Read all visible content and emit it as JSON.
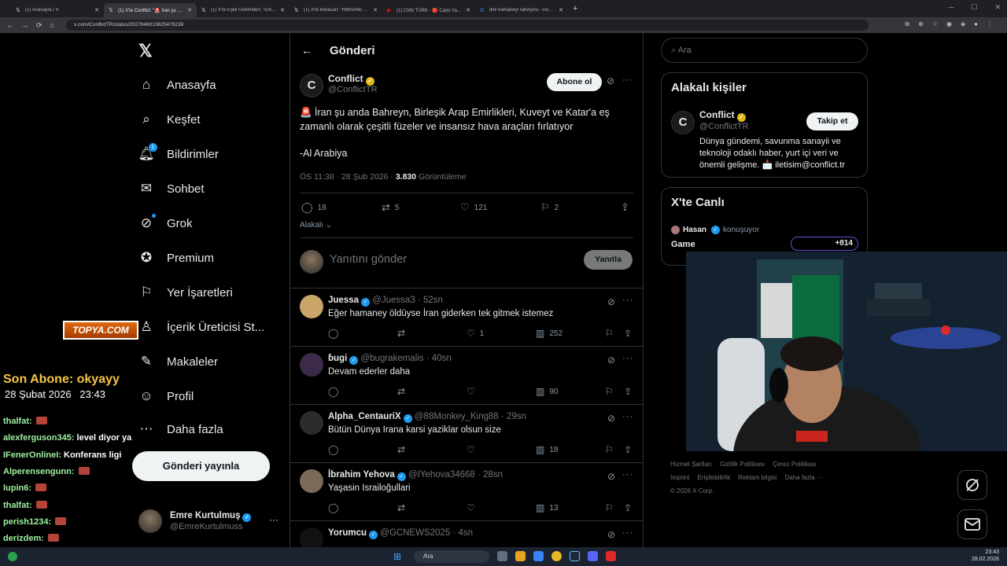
{
  "browser": {
    "tabs": [
      {
        "label": "(1) Anasayfa / X",
        "icon": "x-icon",
        "active": false
      },
      {
        "label": "(1) X'te Conflict: \"🚨 İran şu an...",
        "icon": "x-icon",
        "active": true
      },
      {
        "label": "(1) X'te Eşkil Üretimden: \"Emre...",
        "icon": "x-icon",
        "active": false
      },
      {
        "label": "(1) X'te Boracan: \"Hiltmi//Bu ulu...",
        "icon": "x-icon",
        "active": false
      },
      {
        "label": "(1) CNN TÜRK - 🔴 Canlı Yayın",
        "icon": "youtube-icon",
        "active": false
      },
      {
        "label": "dini hamaneyı takviyesi - Goog...",
        "icon": "google-icon",
        "active": false
      }
    ],
    "url": "x.com/ConflictTR/status/2027846013625479238"
  },
  "nav": {
    "items": [
      {
        "label": "Anasayfa",
        "icon": "home-icon"
      },
      {
        "label": "Keşfet",
        "icon": "search-icon"
      },
      {
        "label": "Bildirimler",
        "icon": "bell-icon",
        "badge": "1"
      },
      {
        "label": "Sohbet",
        "icon": "mail-icon"
      },
      {
        "label": "Grok",
        "icon": "grok-icon"
      },
      {
        "label": "Premium",
        "icon": "premium-icon"
      },
      {
        "label": "Yer İşaretleri",
        "icon": "bookmark-icon"
      },
      {
        "label": "İçerik Üreticisi St...",
        "icon": "creator-studio-icon"
      },
      {
        "label": "Makaleler",
        "icon": "articles-icon"
      },
      {
        "label": "Profil",
        "icon": "profile-icon"
      },
      {
        "label": "Daha fazla",
        "icon": "more-icon"
      }
    ],
    "post_button": "Gönderi yayınla",
    "account": {
      "name": "Emre Kurtulmuş",
      "handle": "@EmreKurtulmuss"
    }
  },
  "main": {
    "header": "Gönderi",
    "tweet": {
      "author": "Conflict",
      "handle": "@ConflictTR",
      "follow_label": "Abone ol",
      "text": "🚨 İran şu anda Bahreyn, Birleşik Arap Emirlikleri, Kuveyt ve Katar'a eş zamanlı olarak çeşitli füzeler ve insansız hava araçları fırlatıyor",
      "source": "-Al Arabiya",
      "time": "ÖS 11:38 · 28 Şub 2026 · ",
      "views_count": "3.830",
      "views_label": " Görüntüleme",
      "replies": "18",
      "reposts": "5",
      "likes": "121",
      "bookmarks": "2"
    },
    "sort_label": "Alakalı",
    "reply_placeholder": "Yanıtını gönder",
    "reply_button": "Yanıtla",
    "replies": [
      {
        "name": "Juessa",
        "handle": "@Juessa3",
        "time": "52sn",
        "text": "Eğer hamaney öldüyse İran giderken tek gitmek istemez",
        "replies": "",
        "reposts": "",
        "likes": "1",
        "views": "252",
        "avatar_color": "#c9a56a"
      },
      {
        "name": "ɓugi",
        "handle": "@bugrakemalis",
        "time": "40sn",
        "text": "Devam ederler daha",
        "replies": "",
        "reposts": "",
        "likes": "",
        "views": "90",
        "avatar_color": "#3b2a4a"
      },
      {
        "name": "Alpha_CentauriX",
        "handle": "@88Monkey_King88",
        "time": "29sn",
        "text": "Bütün Dünya Irana karsi yaziklar olsun size",
        "replies": "",
        "reposts": "",
        "likes": "",
        "views": "18",
        "avatar_color": "#2b2b2b"
      },
      {
        "name": "İbrahim Yehova",
        "handle": "@IYehova34668",
        "time": "28sn",
        "text": "Yaşasin Israiloğullari",
        "replies": "",
        "reposts": "",
        "likes": "",
        "views": "13",
        "avatar_color": "#7a6a5a"
      },
      {
        "name": "Yorumcu",
        "handle": "@GCNEWS2025",
        "time": "4sn",
        "text": "",
        "replies": "",
        "reposts": "",
        "likes": "",
        "views": "",
        "avatar_color": "#111111"
      }
    ]
  },
  "right": {
    "search_placeholder": "Ara",
    "related_title": "Alakalı kişiler",
    "related": {
      "name": "Conflict",
      "handle": "@ConflictTR",
      "follow_label": "Takip et",
      "bio": "Dünya gündemi, savunma sanayii ve teknoloji odaklı haber, yurt içi veri ve önemli gelişme. 📩 iletisim@conflict.tr"
    },
    "live_title": "X'te Canlı",
    "live": {
      "user": "Hasan",
      "status": "konuşuyor",
      "game": "Game",
      "count": "+814"
    },
    "footer": [
      "Hizmet Şartları",
      "Gizlilik Politikası",
      "Çerez Politikası",
      "Imprint",
      "Erişilebilirlik",
      "Reklam bilgisi",
      "Daha fazla ···",
      "© 2026 X Corp."
    ]
  },
  "overlay": {
    "logo_text": "TOPYA.COM",
    "last_sub": "Son Abone: okyayy",
    "date": "28 Şubat 2026",
    "time": "23:43",
    "chat": [
      {
        "user": "thalfat:",
        "msg": ""
      },
      {
        "user": "alexferguson345:",
        "msg": "level diyor ya"
      },
      {
        "user": "IFenerOnlineI:",
        "msg": "Konferans ligi"
      },
      {
        "user": "Alperensengunn:",
        "msg": ""
      },
      {
        "user": "lupin6:",
        "msg": ""
      },
      {
        "user": "thalfat:",
        "msg": ""
      },
      {
        "user": "perish1234:",
        "msg": ""
      },
      {
        "user": "derizdem:",
        "msg": ""
      },
      {
        "user": "thalfat:",
        "msg": ""
      }
    ]
  },
  "taskbar": {
    "search": "Ara",
    "time": "23:43",
    "date": "28.02.2026"
  }
}
